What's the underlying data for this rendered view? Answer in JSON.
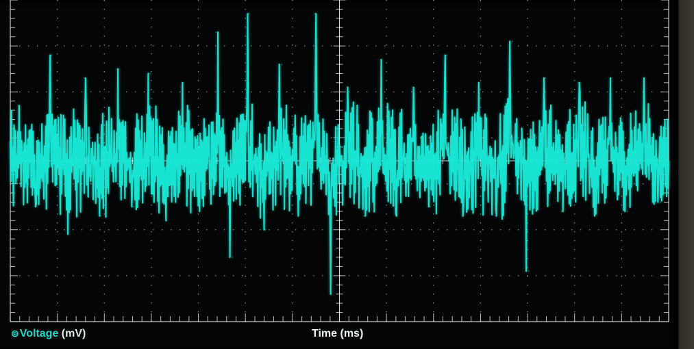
{
  "chart_data": {
    "type": "line",
    "title": "",
    "xlabel": "Time (ms)",
    "ylabel": "",
    "grid": true,
    "legend_placement": "bottom-left",
    "colors": {
      "trace": "#19e8d6",
      "background": "#040506",
      "grid": "#b9c2c2",
      "axis": "#e8eeee"
    },
    "series": [
      {
        "name": "Voltage",
        "unit": "(mV)",
        "marker": "⊚",
        "type": "noisy-waveform",
        "offset_divisions": 0,
        "peak_values_divisions": [
          1.2,
          -1.0,
          2.3,
          -1.6,
          1.8,
          -1.2,
          2.0,
          -1.0,
          1.9,
          -1.3,
          1.7,
          -1.1,
          2.8,
          -2.1,
          3.2,
          -1.5,
          2.1,
          -1.2,
          3.2,
          -2.9,
          1.6,
          -1.2,
          2.2,
          -1.2,
          1.6,
          -1.0,
          2.3,
          -1.0,
          1.7,
          -1.2,
          2.6,
          -2.4,
          1.8,
          -1.1,
          1.7,
          -1.2,
          1.8,
          -1.1,
          1.8,
          -0.9
        ]
      }
    ],
    "x_divisions": 14,
    "y_divisions": 7,
    "y_range_divisions": [
      -3.5,
      3.5
    ]
  }
}
